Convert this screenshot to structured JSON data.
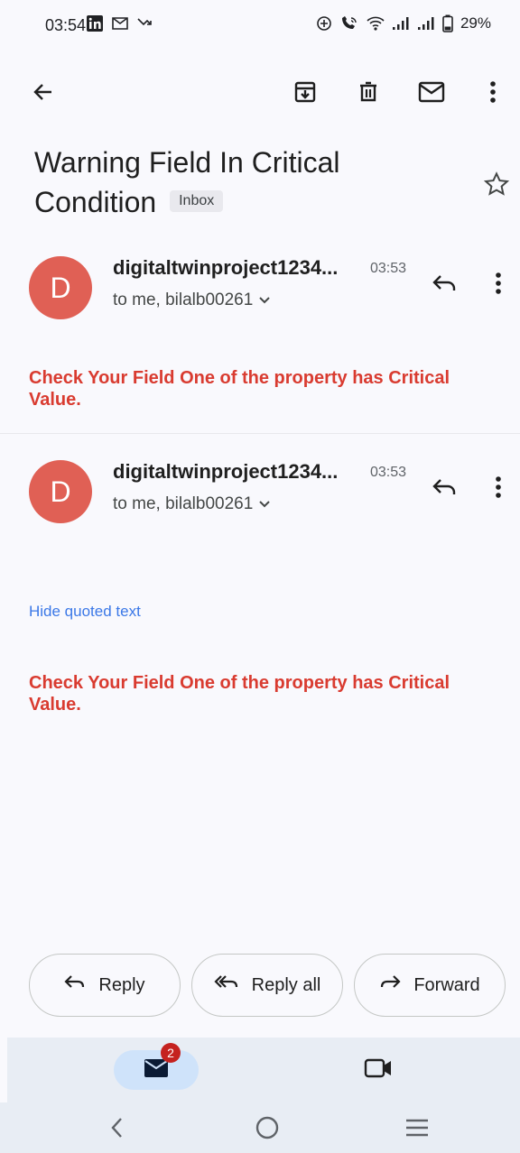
{
  "status_bar": {
    "time": "03:54",
    "battery": "29%",
    "icons_left": [
      "linkedin-icon",
      "gmail-icon",
      "missed-call-icon"
    ],
    "icons_right": [
      "data-saver-icon",
      "wifi-call-icon",
      "wifi-icon",
      "signal-icon",
      "signal-icon",
      "battery-icon"
    ]
  },
  "toolbar": {
    "icons": [
      "back-arrow-icon",
      "archive-icon",
      "delete-icon",
      "mark-unread-icon",
      "more-vert-icon"
    ]
  },
  "email": {
    "subject": "Warning Field In Critical Condition",
    "label_chip": "Inbox"
  },
  "messages": [
    {
      "avatar_letter": "D",
      "sender": "digitaltwinproject1234...",
      "time": "03:53",
      "recipients": "to me, bilalb00261",
      "body": "Check Your Field One of the property has Critical Value."
    },
    {
      "avatar_letter": "D",
      "sender": "digitaltwinproject1234...",
      "time": "03:53",
      "recipients": "to me, bilalb00261",
      "hide_quoted_label": "Hide quoted text",
      "body": "Check Your Field One of the property has Critical Value."
    }
  ],
  "actions": {
    "reply": "Reply",
    "reply_all": "Reply all",
    "forward": "Forward"
  },
  "bottom_nav": {
    "mail_badge": "2",
    "items": [
      "mail-icon",
      "video-camera-icon"
    ]
  },
  "colors": {
    "avatar": "#e06055",
    "body_text": "#d93b30",
    "link": "#3b78e7",
    "badge": "#c5221f",
    "nav_active": "#cfe3fa"
  }
}
